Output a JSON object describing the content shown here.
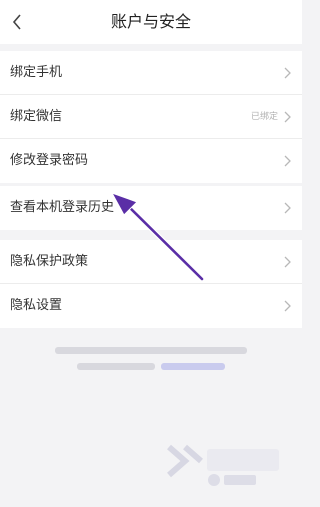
{
  "header": {
    "title": "账户与安全"
  },
  "groups": [
    {
      "items": [
        {
          "label": "绑定手机",
          "value": ""
        },
        {
          "label": "绑定微信",
          "value": "已绑定"
        },
        {
          "label": "修改登录密码",
          "value": ""
        }
      ]
    },
    {
      "items": [
        {
          "label": "查看本机登录历史",
          "value": ""
        }
      ]
    },
    {
      "items": [
        {
          "label": "隐私保护政策",
          "value": ""
        },
        {
          "label": "隐私设置",
          "value": ""
        }
      ]
    }
  ],
  "icons": {
    "back": "chevron-left-icon",
    "row_arrow": "chevron-right-icon"
  },
  "colors": {
    "background": "#f3f3f5",
    "annotation_arrow": "#5a2ea6"
  }
}
